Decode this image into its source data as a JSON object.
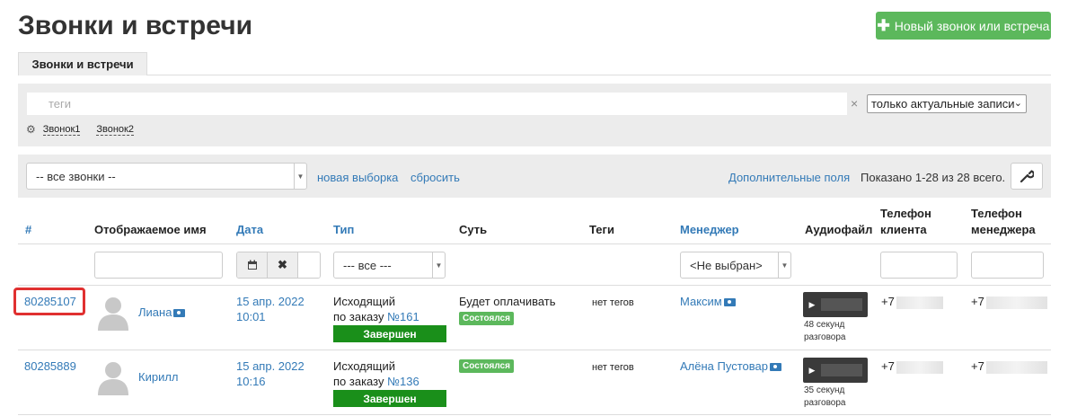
{
  "page": {
    "title": "Звонки и встречи",
    "new_button": "Новый звонок или встреча",
    "tab": "Звонки и встречи"
  },
  "filter": {
    "tags_placeholder": "теги",
    "clear": "×",
    "actual_select": "только актуальные записи",
    "presets": [
      "Звонок1",
      "Звонок2"
    ]
  },
  "toolbar": {
    "calls_select": "-- все звонки --",
    "new_selection": "новая выборка",
    "reset": "сбросить",
    "extra_fields": "Дополнительные поля",
    "shown": "Показано 1-28 из 28 всего."
  },
  "columns": {
    "num": "#",
    "name": "Отображаемое имя",
    "date": "Дата",
    "type": "Тип",
    "essence": "Суть",
    "tags": "Теги",
    "manager": "Менеджер",
    "audio": "Аудиофайл",
    "client_phone_1": "Телефон",
    "client_phone_2": "клиента",
    "manager_phone_1": "Телефон",
    "manager_phone_2": "менеджера"
  },
  "filters_row": {
    "type_select": "--- все ---",
    "manager_select": "<Не выбран>"
  },
  "rows": [
    {
      "id": "80285107",
      "name": "Лиана",
      "date": "15 апр. 2022",
      "time": "10:01",
      "type_line1": "Исходящий",
      "type_line2": "по заказу",
      "order": "№161",
      "status": "Завершен",
      "essence": "Будет оплачивать",
      "essence_badge": "Состоялся",
      "tags": "нет тегов",
      "manager": "Максим",
      "audio_line1": "48 секунд",
      "audio_line2": "разговора",
      "client_phone": "+7",
      "manager_phone": "+7"
    },
    {
      "id": "80285889",
      "name": "Кирилл",
      "date": "15 апр. 2022",
      "time": "10:16",
      "type_line1": "Исходящий",
      "type_line2": "по заказу",
      "order": "№136",
      "status": "Завершен",
      "essence": "",
      "essence_badge": "Состоялся",
      "tags": "нет тегов",
      "manager": "Алёна Пустовар",
      "audio_line1": "35 секунд",
      "audio_line2": "разговора",
      "client_phone": "+7",
      "manager_phone": "+7"
    }
  ],
  "icons": {
    "plus": "plus-icon",
    "gear": "gear-icon",
    "wrench": "wrench-icon",
    "calendar": "calendar-icon",
    "clear": "close-icon",
    "avatar": "user-avatar-icon",
    "card": "id-card-icon",
    "play": "play-icon"
  },
  "colors": {
    "primary_link": "#337ab7",
    "new_button": "#5cb85c",
    "status_done": "#1a8f1a",
    "badge": "#5cb85c",
    "highlight": "#e03030"
  }
}
